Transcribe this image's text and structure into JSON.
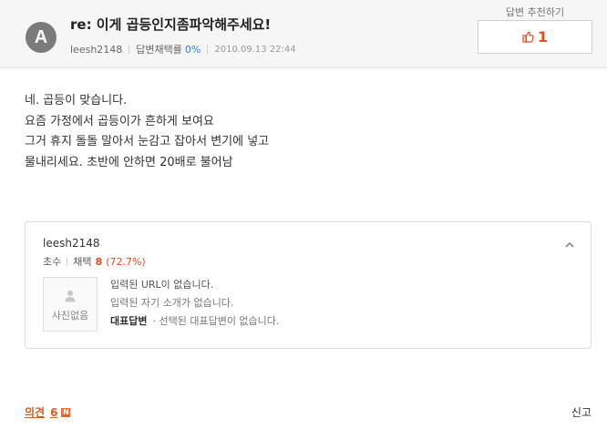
{
  "question": {
    "avatar_letter": "A",
    "title": "re: 이게 곱등인지좀파악해주세요!",
    "author": "leesh2148",
    "adoption_rate_label": "답변채택률",
    "adoption_rate_value": "0%",
    "date": "2010.09.13 22:44"
  },
  "recommend": {
    "label": "답변 추천하기",
    "count": "1"
  },
  "answer": {
    "lines": [
      "네. 곱등이 맞습니다.",
      "요즘 가정에서 곱등이가 흔하게 보여요",
      "그거 휴지 돌돌 말아서 눈감고 잡아서 변기에 넣고",
      "물내리세요. 초반에 안하면 20배로 불어남"
    ]
  },
  "profile": {
    "username": "leesh2148",
    "rank": "초수",
    "adopted_label": "채택",
    "adopted_count": "8",
    "adopted_percent": "(72.7%)",
    "photo_placeholder": "사진없음",
    "no_url": "입력된 URL이 없습니다.",
    "no_intro": "입력된 자기 소개가 없습니다.",
    "rep_answer_label": "대표답변",
    "rep_answer_value": "· 선택된 대표답변이 없습니다."
  },
  "footer": {
    "comments_label": "의견",
    "comments_count": "6",
    "new_badge": "N",
    "report_label": "신고"
  },
  "colors": {
    "accent_orange": "#e0501f",
    "rate_blue": "#3a7bd5",
    "header_bg": "#f6f6f6"
  }
}
